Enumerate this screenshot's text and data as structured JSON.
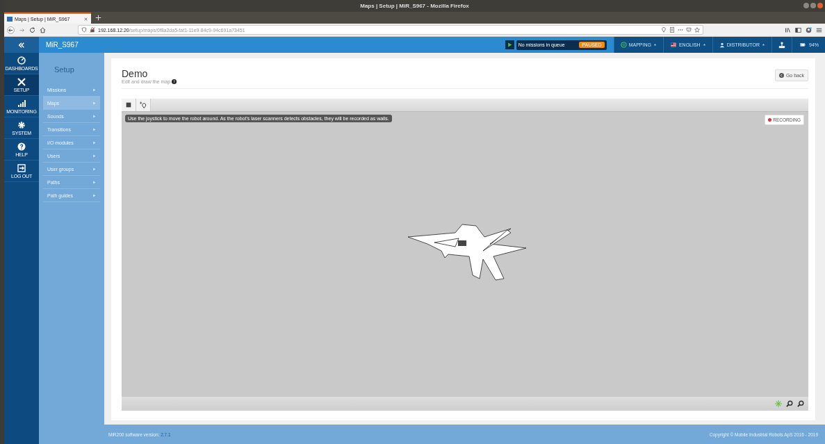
{
  "browser": {
    "window_title": "Maps | Setup | MiR_S967 - Mozilla Firefox",
    "tab_title": "Maps | Setup | MiR_S967",
    "url_host": "192.168.12.20",
    "url_path": "/setup/maps/0f8a2da5-faf1-11e9-84c9-94c691a73451"
  },
  "header": {
    "robot_name": "MiR_S967",
    "mission_status": "No missions in queue",
    "state_badge": "PAUSED",
    "mode": "MAPPING",
    "language": "ENGLISH",
    "user": "DISTRIBUTOR",
    "battery": "94%"
  },
  "rail": [
    {
      "label": "DASHBOARDS",
      "selected": false
    },
    {
      "label": "SETUP",
      "selected": true
    },
    {
      "label": "MONITORING",
      "selected": false
    },
    {
      "label": "SYSTEM",
      "selected": false
    },
    {
      "label": "HELP",
      "selected": false
    },
    {
      "label": "LOG OUT",
      "selected": false
    }
  ],
  "sidebar": {
    "title": "Setup",
    "items": [
      {
        "label": "Missions",
        "selected": false
      },
      {
        "label": "Maps",
        "selected": true
      },
      {
        "label": "Sounds",
        "selected": false
      },
      {
        "label": "Transitions",
        "selected": false
      },
      {
        "label": "I/O modules",
        "selected": false
      },
      {
        "label": "Users",
        "selected": false
      },
      {
        "label": "User groups",
        "selected": false
      },
      {
        "label": "Paths",
        "selected": false
      },
      {
        "label": "Path guides",
        "selected": false
      }
    ]
  },
  "page": {
    "title": "Demo",
    "subtitle": "Edit and draw the map",
    "go_back": "Go back"
  },
  "map": {
    "hint": "Use the joystick to move the robot around. As the robot's laser scanners detects obstacles, they will be recorded as walls.",
    "recording": "RECORDING"
  },
  "footer": {
    "version_label": "MiR200 software version:",
    "version": "2.7.1",
    "copyright": "Copyright © Mobile Industrial Robots ApS 2016 - 2019"
  }
}
